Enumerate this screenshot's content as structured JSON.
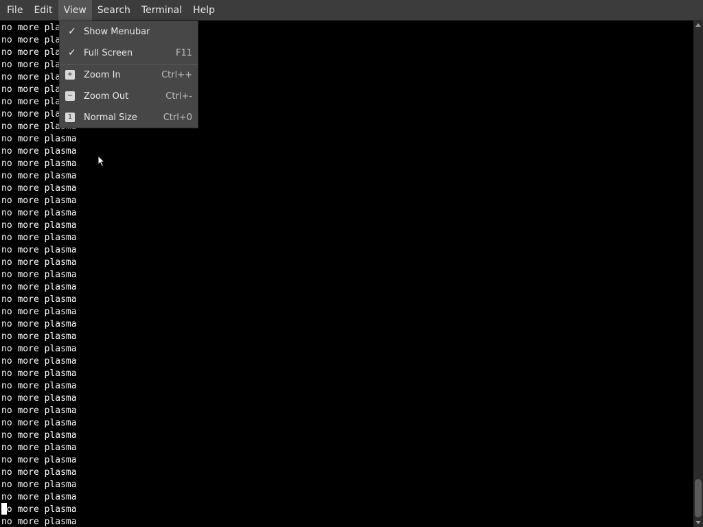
{
  "menubar": {
    "items": [
      {
        "label": "File"
      },
      {
        "label": "Edit"
      },
      {
        "label": "View"
      },
      {
        "label": "Search"
      },
      {
        "label": "Terminal"
      },
      {
        "label": "Help"
      }
    ],
    "active": "View"
  },
  "view_menu": {
    "show_menubar": {
      "label": "Show Menubar",
      "checked": true
    },
    "full_screen": {
      "label": "Full Screen",
      "accel": "F11",
      "checked": true
    },
    "zoom_in": {
      "label": "Zoom In",
      "accel": "Ctrl++"
    },
    "zoom_out": {
      "label": "Zoom Out",
      "accel": "Ctrl+-"
    },
    "normal_size": {
      "label": "Normal Size",
      "accel": "Ctrl+0"
    }
  },
  "icons": {
    "check": "checkmark-icon",
    "zoom_in": "zoom-in-icon",
    "zoom_out": "zoom-out-icon",
    "normal_size": "zoom-original-icon"
  },
  "terminal": {
    "lines": [
      "no more plasma",
      "no more plasma",
      "no more plasma",
      "no more plasma",
      "no more plasma",
      "no more plasma",
      "no more plasma",
      "no more plasma",
      "no more plasma",
      "no more plasma",
      "no more plasma",
      "no more plasma",
      "no more plasma",
      "no more plasma",
      "no more plasma",
      "no more plasma",
      "no more plasma",
      "no more plasma",
      "no more plasma",
      "no more plasma",
      "no more plasma",
      "no more plasma",
      "no more plasma",
      "no more plasma",
      "no more plasma",
      "no more plasma",
      "no more plasma",
      "no more plasma",
      "no more plasma",
      "no more plasma",
      "no more plasma",
      "no more plasma",
      "no more plasma",
      "no more plasma",
      "no more plasma",
      "no more plasma",
      "no more plasma",
      "no more plasma",
      "no more plasma",
      "no more plasma",
      "no more plasma"
    ]
  },
  "colors": {
    "background": "#000000",
    "text": "#ffffff",
    "menubar": "#3c3c3c",
    "menu_popup": "#474747"
  }
}
